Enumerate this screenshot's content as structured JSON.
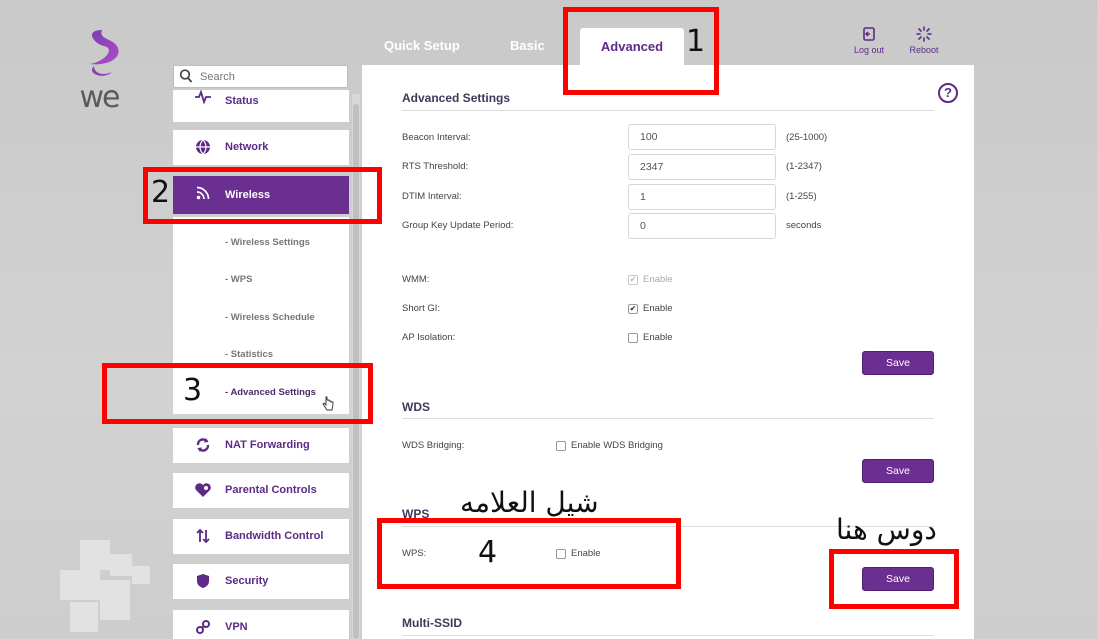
{
  "brand": {
    "logo_text": "we",
    "accent": "#6b2f91"
  },
  "top_nav": {
    "tabs": [
      {
        "label": "Quick Setup",
        "active": false
      },
      {
        "label": "Basic",
        "active": false
      },
      {
        "label": "Advanced",
        "active": true
      }
    ],
    "logout_label": "Log out",
    "reboot_label": "Reboot"
  },
  "search": {
    "placeholder": "Search"
  },
  "sidebar": {
    "items": [
      {
        "label": "Status",
        "icon": "pulse-icon"
      },
      {
        "label": "Network",
        "icon": "globe-icon"
      },
      {
        "label": "Wireless",
        "icon": "wifi-icon",
        "active": true
      },
      {
        "label": "NAT Forwarding",
        "icon": "refresh-icon"
      },
      {
        "label": "Parental Controls",
        "icon": "heart-icon"
      },
      {
        "label": "Bandwidth Control",
        "icon": "arrows-icon"
      },
      {
        "label": "Security",
        "icon": "shield-icon"
      },
      {
        "label": "VPN",
        "icon": "link-icon"
      }
    ],
    "wireless_sub": [
      {
        "label": "- Wireless Settings"
      },
      {
        "label": "- WPS"
      },
      {
        "label": "- Wireless Schedule"
      },
      {
        "label": "- Statistics"
      },
      {
        "label": "- Advanced Settings",
        "current": true
      }
    ]
  },
  "main": {
    "advanced": {
      "title": "Advanced Settings",
      "fields": [
        {
          "label": "Beacon Interval:",
          "value": "100",
          "hint": "(25-1000)"
        },
        {
          "label": "RTS Threshold:",
          "value": "2347",
          "hint": "(1-2347)"
        },
        {
          "label": "DTIM Interval:",
          "value": "1",
          "hint": "(1-255)"
        },
        {
          "label": "Group Key Update Period:",
          "value": "0",
          "hint": "seconds"
        }
      ],
      "checks": [
        {
          "label": "WMM:",
          "option": "Enable",
          "checked": true,
          "disabled": true
        },
        {
          "label": "Short GI:",
          "option": "Enable",
          "checked": true,
          "disabled": false
        },
        {
          "label": "AP Isolation:",
          "option": "Enable",
          "checked": false,
          "disabled": false
        }
      ],
      "save_label": "Save"
    },
    "wds": {
      "title": "WDS",
      "label": "WDS Bridging:",
      "option": "Enable WDS Bridging",
      "save_label": "Save"
    },
    "wps": {
      "title": "WPS",
      "label": "WPS:",
      "option": "Enable",
      "save_label": "Save"
    },
    "multi_ssid": {
      "title": "Multi-SSID"
    },
    "help_glyph": "?"
  },
  "annotations": {
    "n1": "1",
    "n2": "2",
    "n3": "3",
    "n4": "4",
    "remove_check_text": "شيل العلامه",
    "click_here_text": "دوس هنا",
    "box_color": "#ff0000"
  }
}
